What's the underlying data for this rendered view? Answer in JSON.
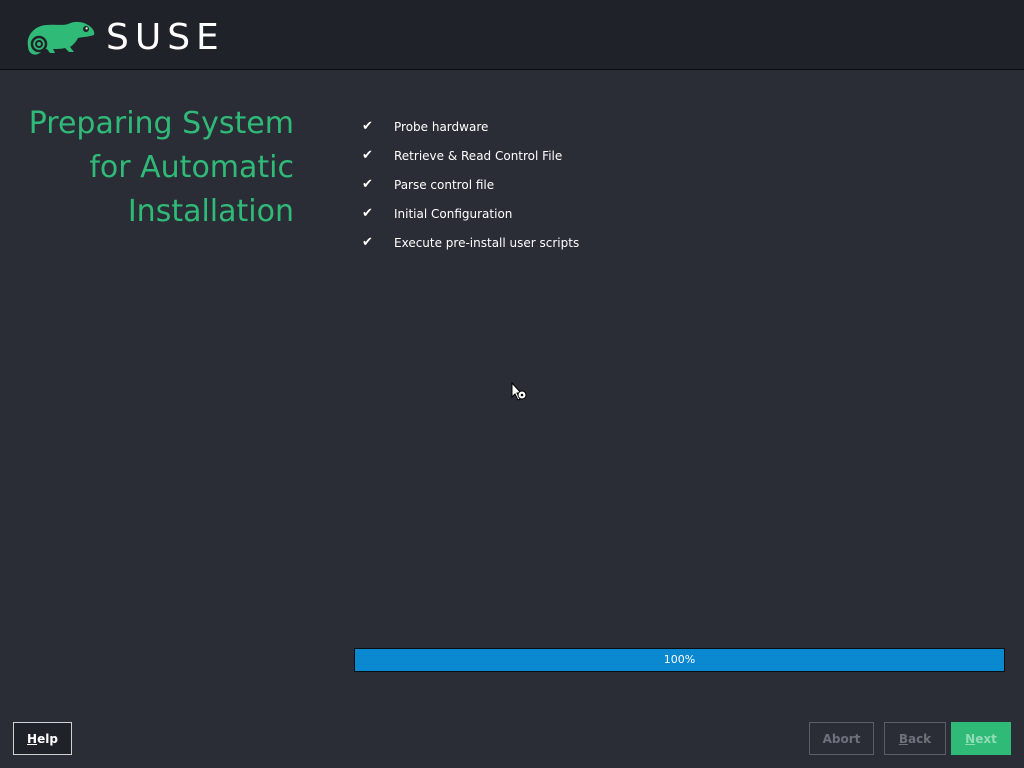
{
  "header": {
    "brand": "SUSE",
    "logo_icon": "chameleon-logo-icon",
    "brand_color": "#30ba78"
  },
  "title": {
    "line1": "Preparing System",
    "line2": "for Automatic",
    "line3": "Installation"
  },
  "steps": [
    {
      "status": "✔",
      "label": "Probe hardware"
    },
    {
      "status": "✔",
      "label": "Retrieve & Read Control File"
    },
    {
      "status": "✔",
      "label": "Parse control file"
    },
    {
      "status": "✔",
      "label": "Initial Configuration"
    },
    {
      "status": "✔",
      "label": "Execute pre-install user scripts"
    }
  ],
  "progress": {
    "value": 100,
    "label": "100%",
    "color": "#0a88d0"
  },
  "buttons": {
    "help": {
      "label": "Help",
      "mnemonic": "H",
      "rest": "elp"
    },
    "abort": {
      "label": "Abort",
      "enabled": false
    },
    "back": {
      "label": "Back",
      "mnemonic": "B",
      "rest": "ack",
      "enabled": false
    },
    "next": {
      "label": "Next",
      "mnemonic": "N",
      "rest": "ext",
      "enabled": false
    }
  },
  "cursor_icon": "busy-pointer-icon"
}
